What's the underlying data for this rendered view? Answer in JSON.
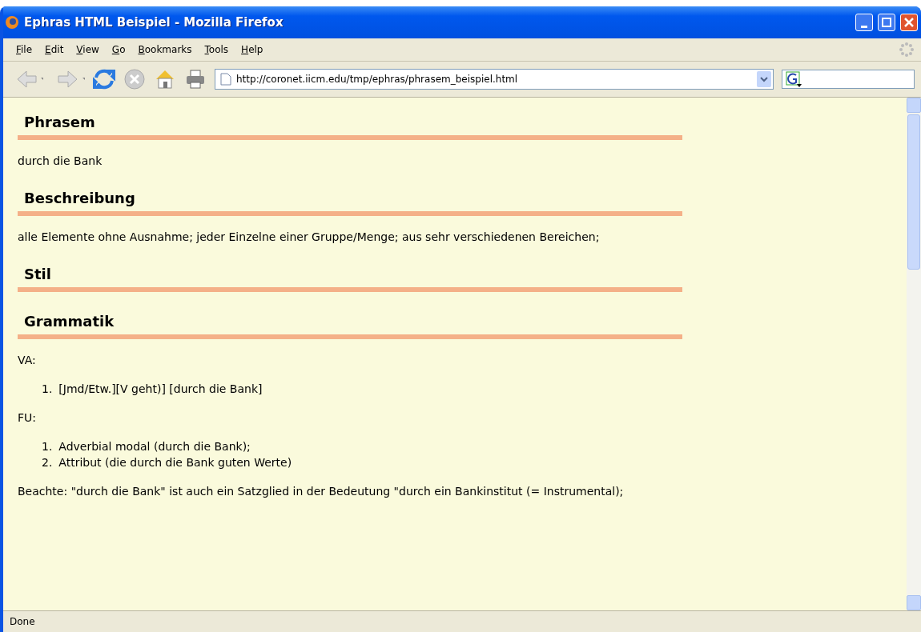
{
  "window": {
    "title": "Ephras HTML Beispiel - Mozilla Firefox"
  },
  "menu": [
    "File",
    "Edit",
    "View",
    "Go",
    "Bookmarks",
    "Tools",
    "Help"
  ],
  "address_bar": {
    "value": "http://coronet.iicm.edu/tmp/ephras/phrasem_beispiel.html"
  },
  "content": [
    {
      "kind": "heading",
      "text": "Phrasem"
    },
    {
      "kind": "paragraph",
      "text": "durch die Bank"
    },
    {
      "kind": "heading",
      "text": "Beschreibung"
    },
    {
      "kind": "paragraph",
      "text": "alle Elemente ohne Ausnahme; jeder Einzelne einer Gruppe/Menge; aus sehr verschiedenen Bereichen;"
    },
    {
      "kind": "heading",
      "text": "Stil"
    },
    {
      "kind": "heading",
      "text": "Grammatik"
    },
    {
      "kind": "paragraph",
      "text": "VA:"
    },
    {
      "kind": "list",
      "items": [
        {
          "marker": "1.",
          "text": "[Jmd/Etw.][V geht)] [durch die Bank]"
        }
      ]
    },
    {
      "kind": "paragraph",
      "text": "FU:"
    },
    {
      "kind": "list",
      "items": [
        {
          "marker": "1.",
          "text": "Adverbial modal (durch die Bank);"
        },
        {
          "marker": "2.",
          "text": "Attribut (die durch die Bank guten Werte)"
        }
      ]
    },
    {
      "kind": "paragraph",
      "text": "Beachte: \"durch die Bank\" ist auch ein Satzglied in der Bedeutung \"durch ein Bankinstitut (= Instrumental);"
    }
  ],
  "status_bar": {
    "text": "Done"
  }
}
